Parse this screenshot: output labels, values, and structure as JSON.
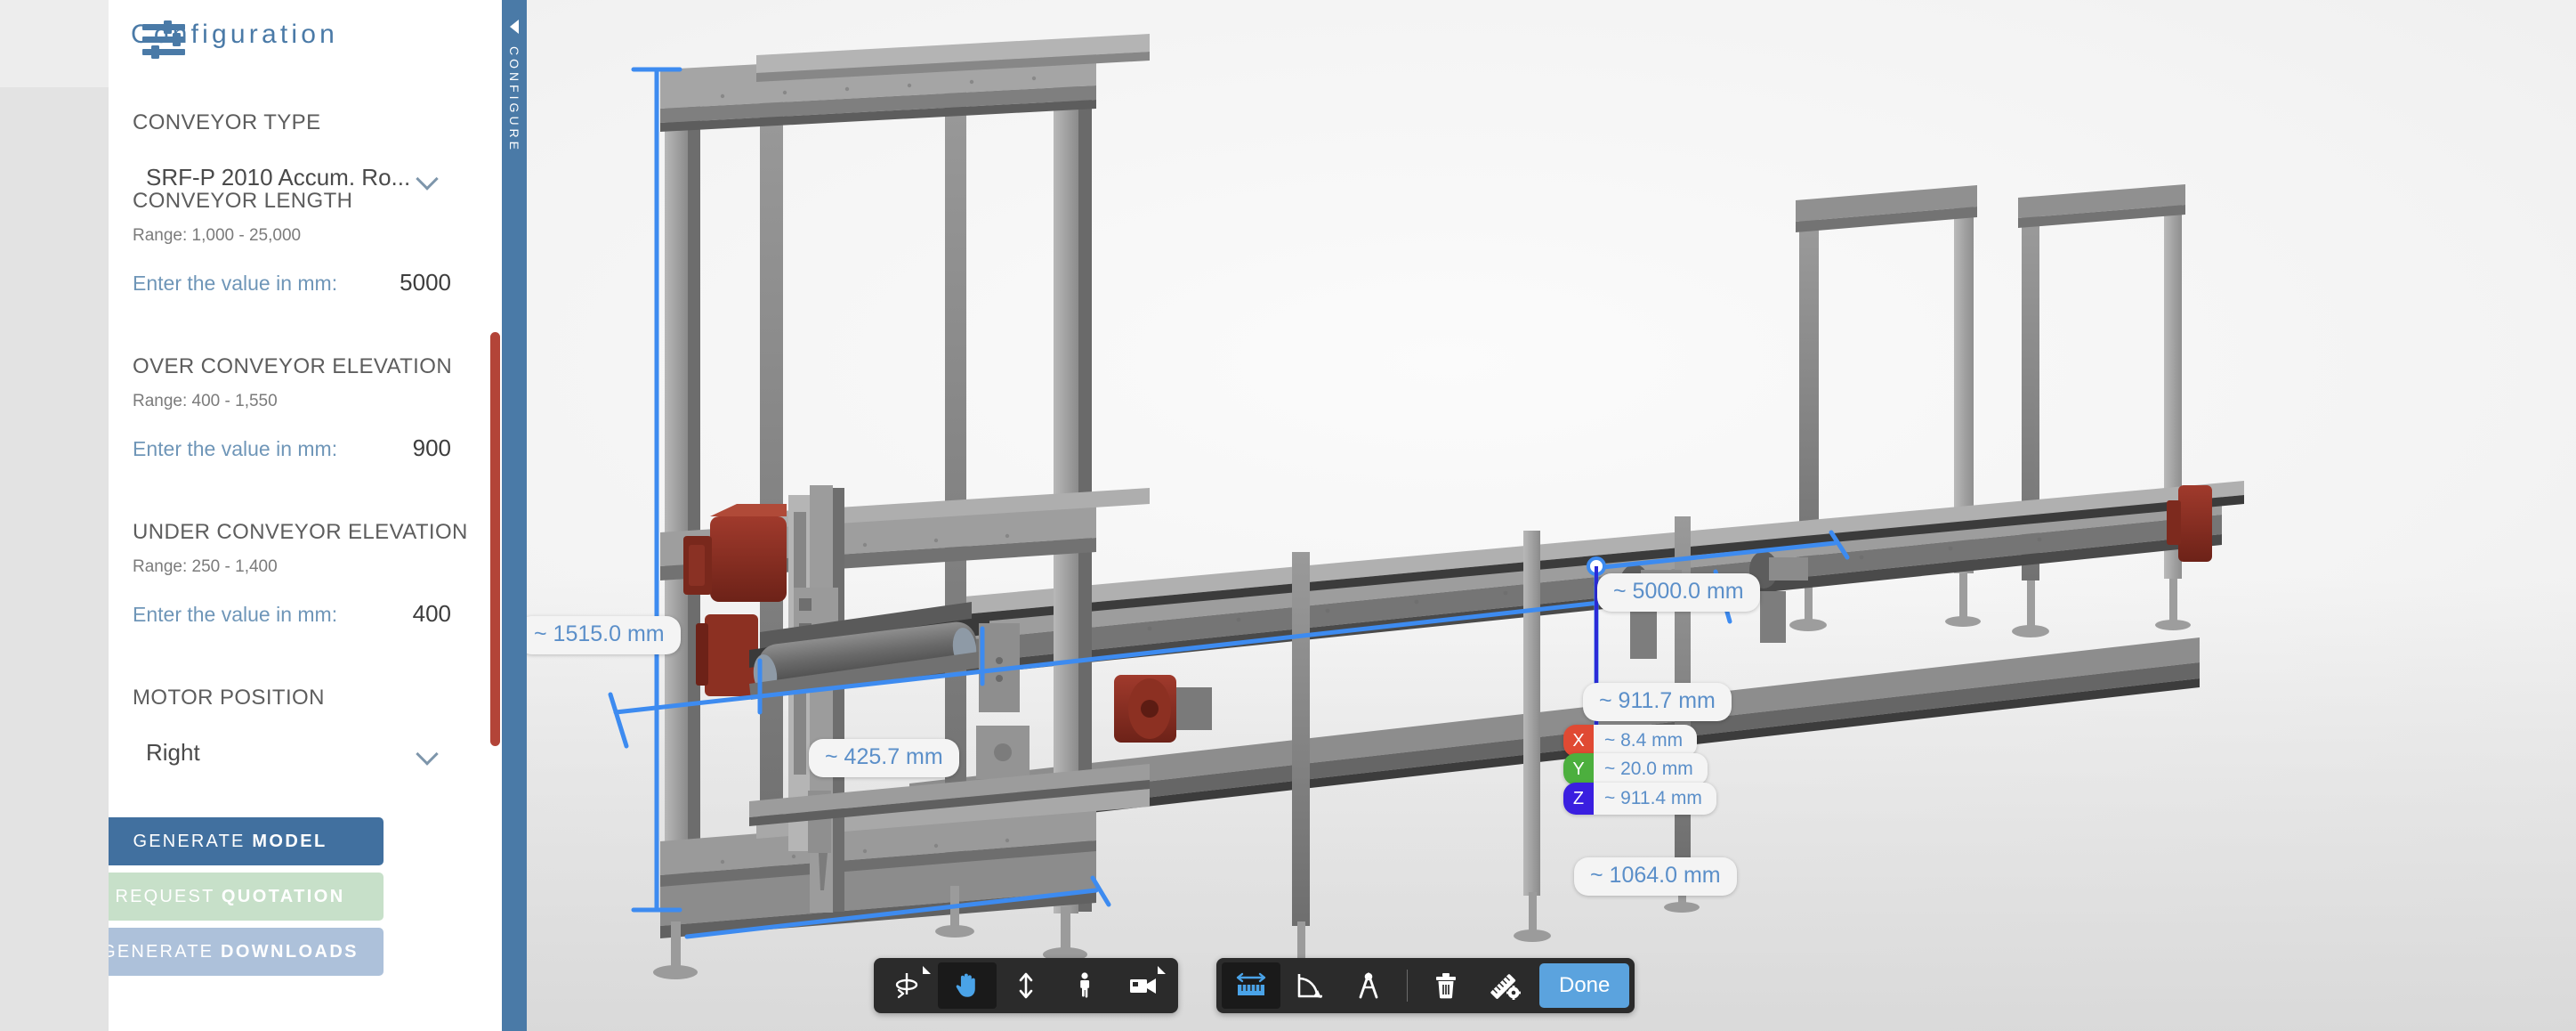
{
  "panel": {
    "title": "Configuration",
    "icon": "sliders-icon",
    "fields": [
      {
        "id": "conveyor-type",
        "label": "CONVEYOR TYPE",
        "kind": "select",
        "value": "SRF-P 2010 Accum. Ro..."
      },
      {
        "id": "conveyor-length",
        "label": "CONVEYOR LENGTH",
        "kind": "number",
        "range": "Range: 1,000 - 25,000",
        "hint": "Enter the value in mm:",
        "value": "5000"
      },
      {
        "id": "over-conveyor-elevation",
        "label": "OVER CONVEYOR ELEVATION",
        "kind": "number",
        "range": "Range: 400 - 1,550",
        "hint": "Enter the value in mm:",
        "value": "900"
      },
      {
        "id": "under-conveyor-elevation",
        "label": "UNDER CONVEYOR ELEVATION",
        "kind": "number",
        "range": "Range: 250 - 1,400",
        "hint": "Enter the value in mm:",
        "value": "400"
      },
      {
        "id": "motor-position",
        "label": "MOTOR POSITION",
        "kind": "select",
        "value": "Right"
      }
    ],
    "actions": [
      {
        "id": "generate-model",
        "light": "GENERATE ",
        "bold": "MODEL",
        "color": "#41709f"
      },
      {
        "id": "request-quotation",
        "light": "REQUEST ",
        "bold": "QUOTATION",
        "color": "#c7e0c9"
      },
      {
        "id": "generate-downloads",
        "light": "GENERATE ",
        "bold": "DOWNLOADS",
        "color": "#adc1da"
      }
    ],
    "scrollbar_color": "#b34438"
  },
  "configure_tab": {
    "label": "CONFIGURE",
    "arrow": "collapse-left-arrow",
    "color": "#4a7aa7"
  },
  "viewport": {
    "measurements": [
      {
        "id": "height-1515",
        "text": "~ 1515.0 mm"
      },
      {
        "id": "length-5000",
        "text": "~ 5000.0 mm"
      },
      {
        "id": "width-425",
        "text": "~ 425.7 mm"
      },
      {
        "id": "depth-1064",
        "text": "~ 1064.0 mm"
      },
      {
        "id": "dist-911-7",
        "text": "~ 911.7 mm"
      }
    ],
    "axis_measurements": [
      {
        "axis": "X",
        "text": "~ 8.4 mm",
        "color": "#e04a33"
      },
      {
        "axis": "Y",
        "text": "~ 20.0 mm",
        "color": "#4caf3e"
      },
      {
        "axis": "Z",
        "text": "~ 911.4 mm",
        "color": "#3a1fe0"
      }
    ]
  },
  "toolbar_left": {
    "buttons": [
      {
        "id": "orbit",
        "icon": "orbit-rotate-icon",
        "active": false,
        "has_menu": true
      },
      {
        "id": "pan",
        "icon": "pan-hand-icon",
        "active": true,
        "has_menu": false
      },
      {
        "id": "zoom",
        "icon": "zoom-updown-icon",
        "active": false,
        "has_menu": false
      },
      {
        "id": "walk",
        "icon": "walk-person-icon",
        "active": false,
        "has_menu": false
      },
      {
        "id": "camera",
        "icon": "camera-icon",
        "active": false,
        "has_menu": true
      }
    ]
  },
  "toolbar_right": {
    "buttons": [
      {
        "id": "measure-distance",
        "icon": "ruler-distance-icon",
        "active": true
      },
      {
        "id": "measure-angle",
        "icon": "angle-icon",
        "active": false
      },
      {
        "id": "measure-text",
        "icon": "caliper-icon",
        "active": false
      },
      {
        "id": "delete",
        "icon": "trash-icon",
        "active": false
      },
      {
        "id": "measure-settings",
        "icon": "ruler-gear-icon",
        "active": false
      }
    ],
    "done_label": "Done"
  }
}
